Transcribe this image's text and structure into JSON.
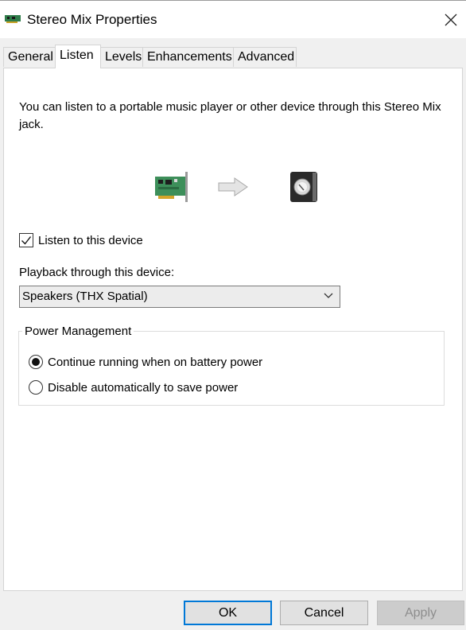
{
  "window": {
    "title": "Stereo Mix Properties"
  },
  "icons": {
    "title_icon": "sound-card-icon",
    "close": "close-icon",
    "source": "sound-card-icon",
    "arrow": "arrow-right-icon",
    "target": "speaker-icon",
    "dropdown": "chevron-down-icon"
  },
  "tabs": [
    {
      "label": "General",
      "active": false
    },
    {
      "label": "Listen",
      "active": true
    },
    {
      "label": "Levels",
      "active": false
    },
    {
      "label": "Enhancements",
      "active": false
    },
    {
      "label": "Advanced",
      "active": false
    }
  ],
  "listen": {
    "description": "You can listen to a portable music player or other device through this Stereo Mix jack.",
    "checkbox_label": "Listen to this device",
    "checkbox_checked": true,
    "playback_label": "Playback through this device:",
    "playback_value": "Speakers (THX Spatial)"
  },
  "power": {
    "legend": "Power Management",
    "options": [
      {
        "label": "Continue running when on battery power",
        "selected": true
      },
      {
        "label": "Disable automatically to save power",
        "selected": false
      }
    ]
  },
  "buttons": {
    "ok": "OK",
    "cancel": "Cancel",
    "apply": "Apply",
    "apply_enabled": false
  },
  "colors": {
    "accent": "#0078d7",
    "panel_bg": "#ffffff",
    "window_bg": "#f0f0f0"
  }
}
